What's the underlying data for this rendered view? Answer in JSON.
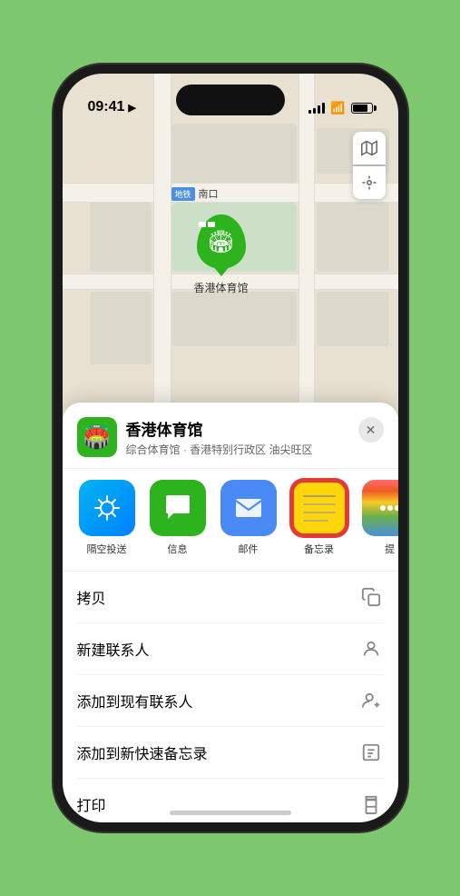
{
  "statusBar": {
    "time": "09:41",
    "locationArrow": "▶"
  },
  "map": {
    "nankou_tag": "南口",
    "nankou_prefix": "地铁"
  },
  "venue": {
    "name": "香港体育馆",
    "subtitle": "综合体育馆 · 香港特别行政区 油尖旺区",
    "icon": "🏟️"
  },
  "shareItems": [
    {
      "id": "airdrop",
      "label": "隔空投送",
      "type": "airdrop"
    },
    {
      "id": "messages",
      "label": "信息",
      "type": "messages"
    },
    {
      "id": "mail",
      "label": "邮件",
      "type": "mail"
    },
    {
      "id": "notes",
      "label": "备忘录",
      "type": "notes",
      "selected": true
    },
    {
      "id": "more",
      "label": "提",
      "type": "more"
    }
  ],
  "actions": [
    {
      "id": "copy",
      "label": "拷贝",
      "icon": "📋"
    },
    {
      "id": "new-contact",
      "label": "新建联系人",
      "icon": "👤"
    },
    {
      "id": "add-existing",
      "label": "添加到现有联系人",
      "icon": "👤"
    },
    {
      "id": "add-note",
      "label": "添加到新快速备忘录",
      "icon": "📋"
    },
    {
      "id": "print",
      "label": "打印",
      "icon": "🖨️"
    }
  ],
  "closeBtn": "✕",
  "mapLabel": "南口"
}
